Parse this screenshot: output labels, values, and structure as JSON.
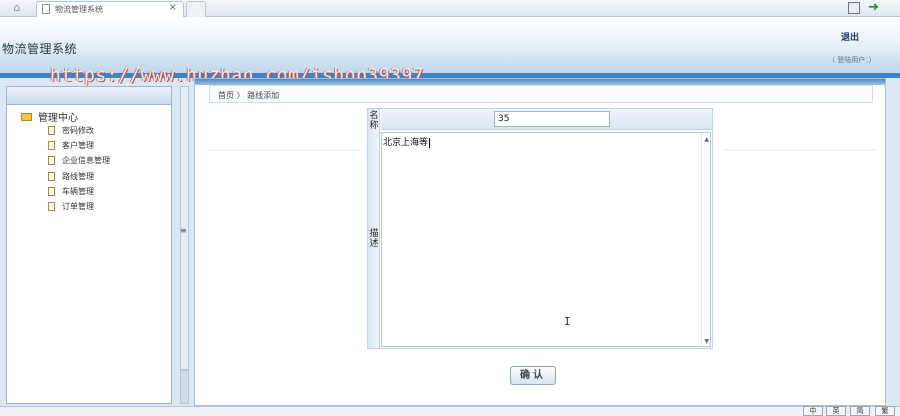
{
  "browser": {
    "tab_title": "物流管理系统",
    "tab_close": "×"
  },
  "header": {
    "title": "物流管理系统",
    "logout": "退出",
    "welcome": "（ 登陆用户：）",
    "watermark": "https://www.huzhan.com/ishop39397"
  },
  "sidebar": {
    "root": "管理中心",
    "items": [
      {
        "label": "密码修改"
      },
      {
        "label": "客户管理"
      },
      {
        "label": "企业信息管理"
      },
      {
        "label": "路线管理"
      },
      {
        "label": "车辆管理"
      },
      {
        "label": "订单管理"
      }
    ],
    "grip": "≡"
  },
  "main": {
    "breadcrumb": "首页 〉 路线添加",
    "name_label": "名称",
    "name_value": "35",
    "desc_label": "描述",
    "desc_value": "北京上海等",
    "confirm": "确认"
  },
  "statusbar": {
    "buttons": [
      "中",
      "英",
      "简",
      "繁"
    ]
  },
  "colors": {
    "accent": "#3d83c6",
    "header_gradient_end": "#b9d2ea"
  }
}
